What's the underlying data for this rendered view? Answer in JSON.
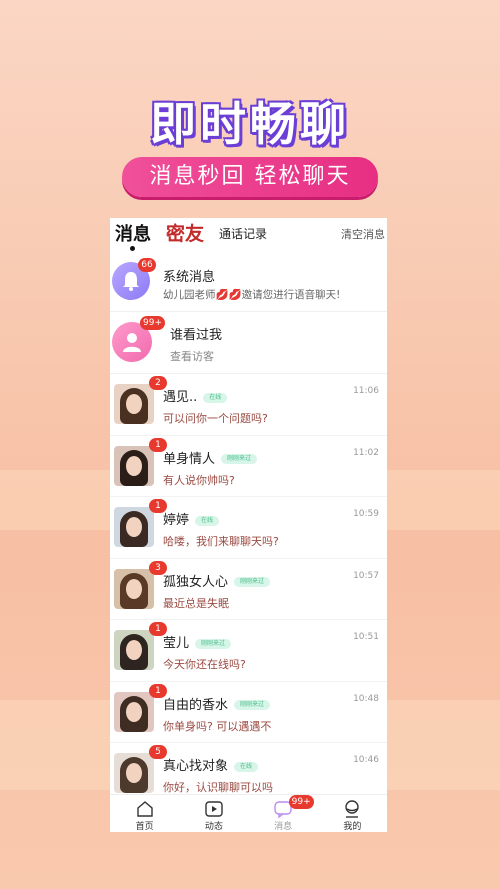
{
  "banner": {
    "headline": "即时畅聊",
    "subline": "消息秒回  轻松聊天"
  },
  "tabs": {
    "messages": "消息",
    "friends": "密友",
    "calls": "通话记录",
    "clear": "清空消息"
  },
  "system": {
    "title": "系统消息",
    "subtitle": "幼儿园老师💋💋邀请您进行语音聊天!",
    "badge": "66"
  },
  "visitors": {
    "title": "谁看过我",
    "subtitle": "查看访客",
    "badge": "99+"
  },
  "conversations": [
    {
      "name": "遇见..",
      "tag": "在线",
      "message": "可以问你一个问题吗?",
      "time": "11:06",
      "badge": "2"
    },
    {
      "name": "单身情人",
      "tag": "刚刚来过",
      "message": "有人说你帅吗?",
      "time": "11:02",
      "badge": "1"
    },
    {
      "name": "婷婷",
      "tag": "在线",
      "message": "哈喽，我们来聊聊天吗?",
      "time": "10:59",
      "badge": "1"
    },
    {
      "name": "孤独女人心",
      "tag": "刚刚来过",
      "message": "最近总是失眠",
      "time": "10:57",
      "badge": "3"
    },
    {
      "name": "莹儿",
      "tag": "刚刚来过",
      "message": "今天你还在线吗?",
      "time": "10:51",
      "badge": "1"
    },
    {
      "name": "自由的香水",
      "tag": "刚刚来过",
      "message": "你单身吗? 可以遇遇不",
      "time": "10:48",
      "badge": "1"
    },
    {
      "name": "真心找对象",
      "tag": "在线",
      "message": "你好，认识聊聊可以吗",
      "time": "10:46",
      "badge": "5"
    }
  ],
  "nav": {
    "home": "首页",
    "feed": "动态",
    "messages": "消息",
    "messages_badge": "99+",
    "mine": "我的"
  },
  "colors": {
    "accent_pink": "#e72e83",
    "headline_outline": "#6b3fd6",
    "badge_red": "#e8392e",
    "friends_tab_red": "#c32a2a"
  }
}
